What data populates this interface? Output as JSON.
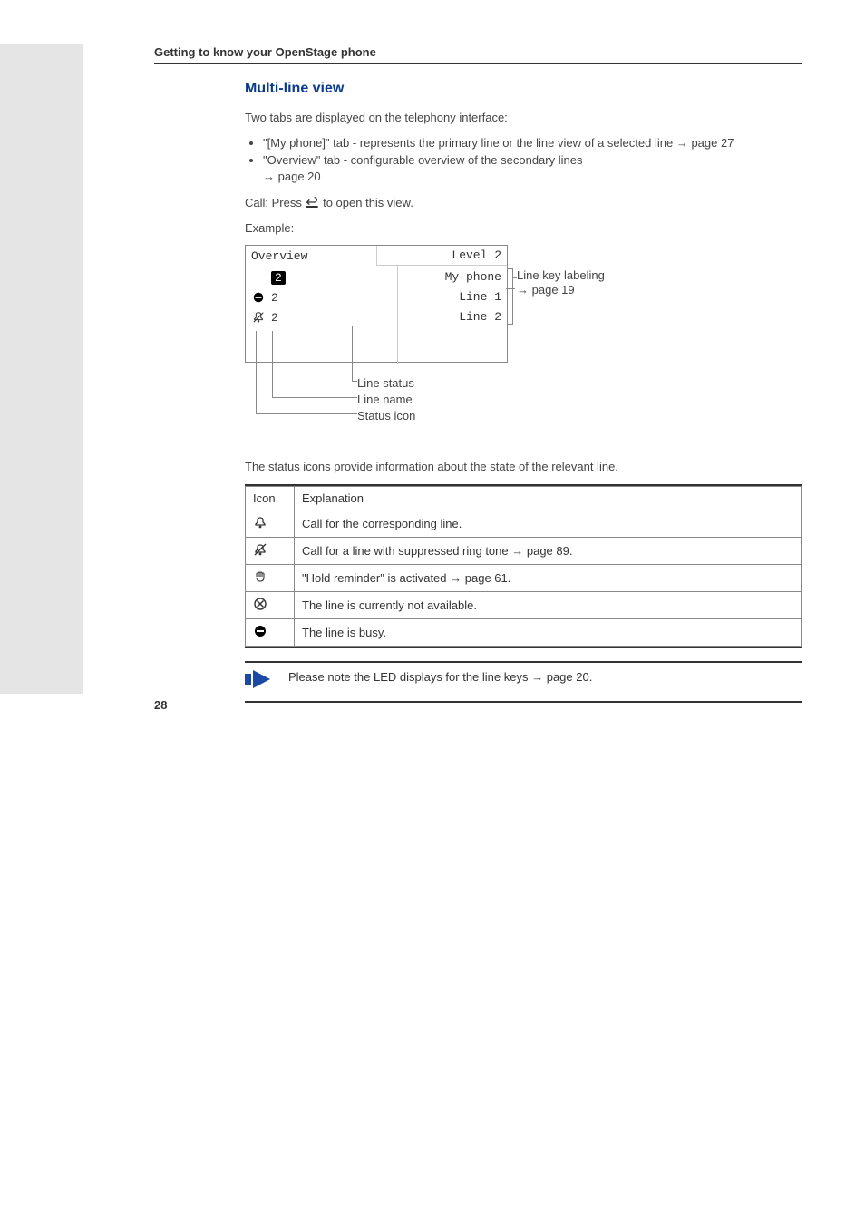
{
  "header": {
    "title": "Getting to know your OpenStage phone"
  },
  "section": {
    "title": "Multi-line view"
  },
  "intro": "Two tabs are displayed on the telephony interface:",
  "bullets": [
    {
      "text_a": "\"[My phone]\" tab - represents the primary line or the line view of a selected line",
      "page_ref": "page 27"
    },
    {
      "text_a": "\"Overview\" tab - configurable overview of the secondary lines",
      "page_ref": "page 20"
    }
  ],
  "call_line": {
    "prefix": "Call: Press ",
    "suffix": " to open this view."
  },
  "example_label": "Example:",
  "diagram": {
    "tabs": {
      "left": "Overview",
      "right": "Level 2"
    },
    "rows": [
      {
        "icon": "",
        "name": "2",
        "right": "My phone",
        "selected": true
      },
      {
        "icon": "busy",
        "name": "2",
        "right": "Line 1",
        "selected": false
      },
      {
        "icon": "bell-struck",
        "name": "2",
        "right": "Line 2",
        "selected": false
      }
    ],
    "annotations": {
      "line_key_labeling": "Line key labeling",
      "page19": "page 19",
      "line_status": "Line status",
      "line_name": "Line name",
      "status_icon": "Status icon"
    }
  },
  "status_para": "The status icons provide information about the state of the relevant line.",
  "table": {
    "headers": {
      "icon": "Icon",
      "expl": "Explanation"
    },
    "rows": [
      {
        "icon": "bell",
        "text": "Call for the corresponding line."
      },
      {
        "icon": "bell-struck",
        "text": "Call for a line with suppressed ring tone ",
        "page_ref": "page 89."
      },
      {
        "icon": "hand",
        "text": "\"Hold reminder\" is activated ",
        "page_ref": "page 61."
      },
      {
        "icon": "circle-x",
        "text": "The line is currently not available."
      },
      {
        "icon": "busy",
        "text": "The line is busy."
      }
    ]
  },
  "note": {
    "text": "Please note the LED displays for the line keys ",
    "page_ref": "page 20."
  },
  "page_number": "28",
  "arrow_glyph": "→"
}
